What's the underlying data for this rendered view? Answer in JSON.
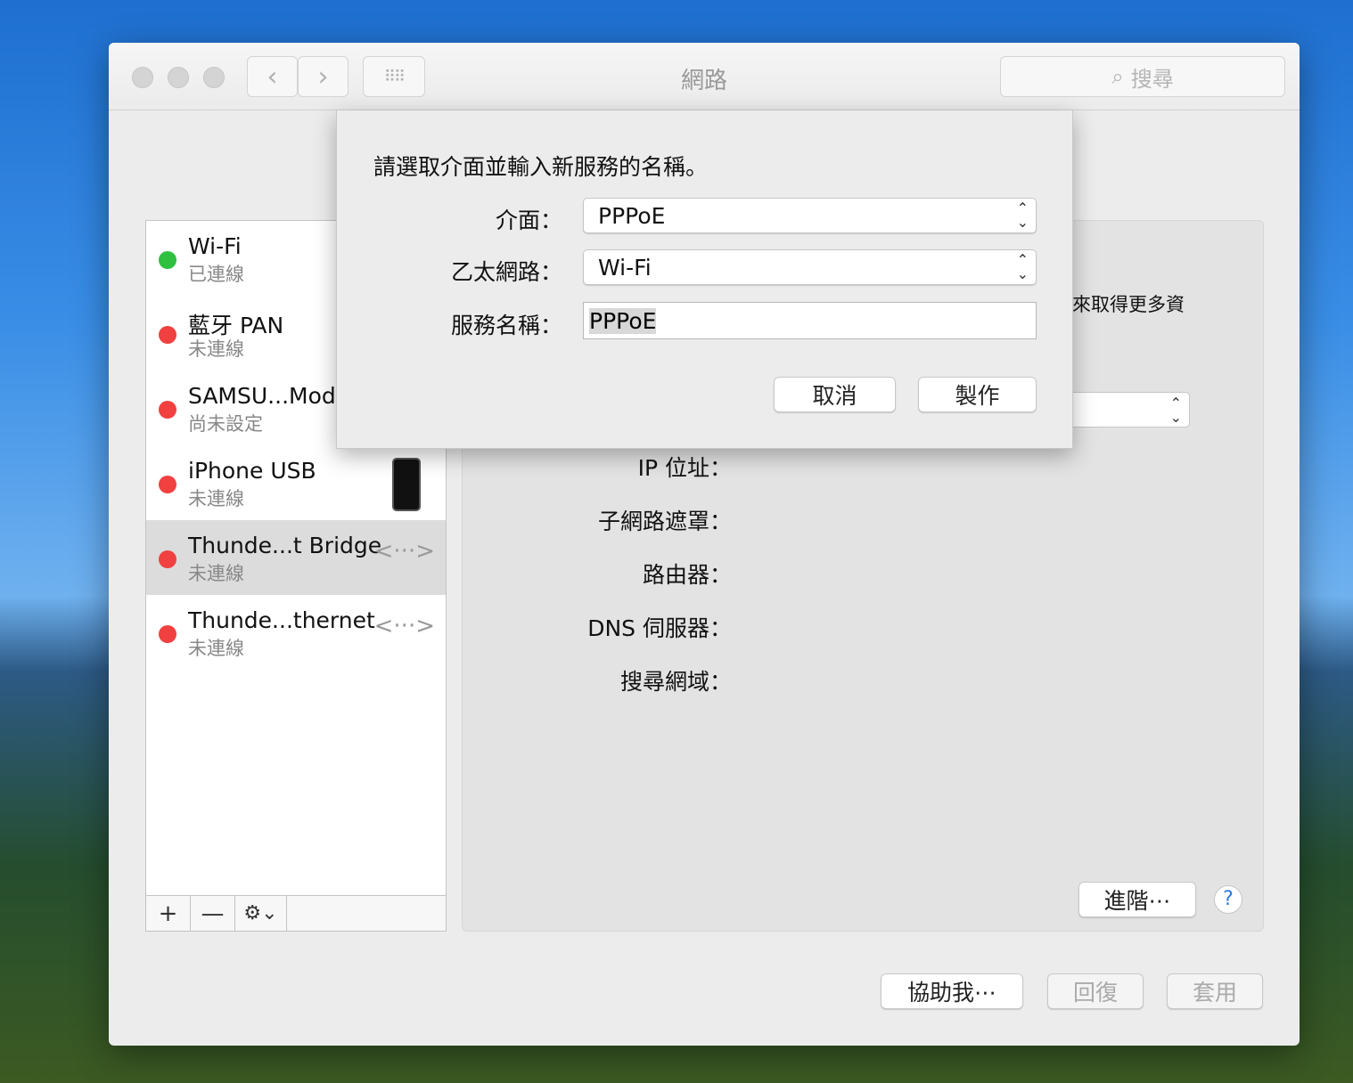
{
  "window": {
    "title": "網路",
    "search_placeholder": "搜尋"
  },
  "sidebar": {
    "items": [
      {
        "name": "Wi-Fi",
        "status": "已連線",
        "color": "#30c040",
        "icon": ""
      },
      {
        "name": "藍牙 PAN",
        "status": "未連線",
        "color": "#f04040",
        "icon": ""
      },
      {
        "name": "SAMSU...Modem",
        "status": "尚未設定",
        "color": "#f04040",
        "icon": ""
      },
      {
        "name": "iPhone USB",
        "status": "未連線",
        "color": "#f04040",
        "icon": "phone"
      },
      {
        "name": "Thunde...t Bridge",
        "status": "未連線",
        "color": "#f04040",
        "icon": "<···>"
      },
      {
        "name": "Thunde...thernet",
        "status": "未連線",
        "color": "#f04040",
        "icon": "<···>"
      }
    ],
    "add": "+",
    "remove": "—",
    "gear": "⚙⌄"
  },
  "panel": {
    "partial_text": "來取得更多資",
    "labels": [
      "IP 位址：",
      "子網路遮罩：",
      "路由器：",
      "DNS 伺服器：",
      "搜尋網域："
    ],
    "advanced": "進階⋯",
    "help": "?"
  },
  "footer": {
    "assist": "協助我⋯",
    "revert": "回復",
    "apply": "套用"
  },
  "dialog": {
    "prompt": "請選取介面並輸入新服務的名稱。",
    "interface_label": "介面：",
    "interface_value": "PPPoE",
    "ethernet_label": "乙太網路：",
    "ethernet_value": "Wi-Fi",
    "service_label": "服務名稱：",
    "service_value": "PPPoE",
    "cancel": "取消",
    "create": "製作"
  }
}
